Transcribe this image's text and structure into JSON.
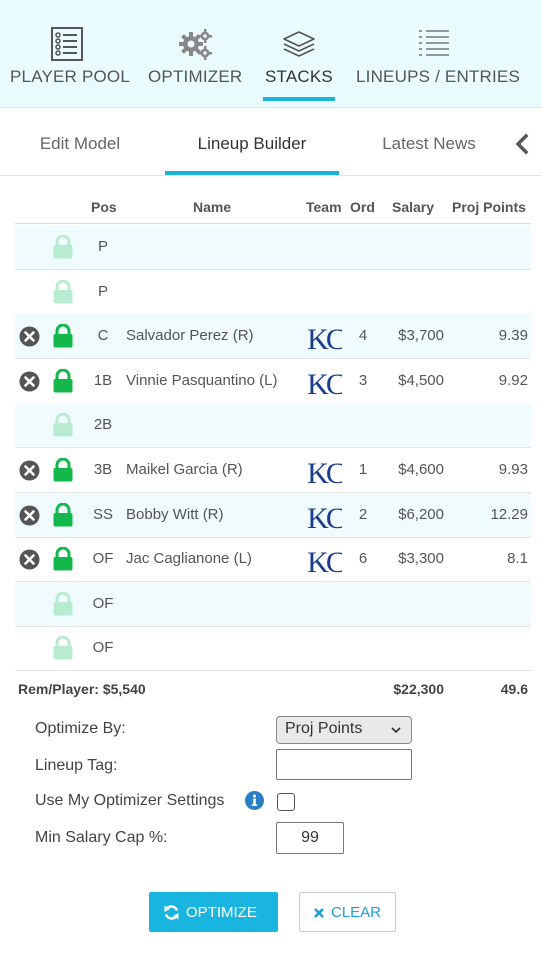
{
  "nav": {
    "player_pool": "PLAYER POOL",
    "optimizer": "OPTIMIZER",
    "stacks": "STACKS",
    "lineups": "LINEUPS / ENTRIES",
    "active": "stacks"
  },
  "subtabs": {
    "edit_model": "Edit Model",
    "lineup_builder": "Lineup Builder",
    "latest_news": "Latest News",
    "active": "lineup_builder"
  },
  "table": {
    "headers": {
      "pos": "Pos",
      "name": "Name",
      "team": "Team",
      "ord": "Ord",
      "salary": "Salary",
      "proj_points": "Proj Points"
    },
    "rows": [
      {
        "pos": "P",
        "name": "",
        "team": "",
        "ord": "",
        "salary": "",
        "proj": "",
        "locked": false,
        "filled": false
      },
      {
        "pos": "P",
        "name": "",
        "team": "",
        "ord": "",
        "salary": "",
        "proj": "",
        "locked": false,
        "filled": false
      },
      {
        "pos": "C",
        "name": "Salvador Perez (R)",
        "team": "KC",
        "ord": "4",
        "salary": "$3,700",
        "proj": "9.39",
        "locked": true,
        "filled": true
      },
      {
        "pos": "1B",
        "name": "Vinnie Pasquantino (L)",
        "team": "KC",
        "ord": "3",
        "salary": "$4,500",
        "proj": "9.92",
        "locked": true,
        "filled": true
      },
      {
        "pos": "2B",
        "name": "",
        "team": "",
        "ord": "",
        "salary": "",
        "proj": "",
        "locked": false,
        "filled": false
      },
      {
        "pos": "3B",
        "name": "Maikel Garcia (R)",
        "team": "KC",
        "ord": "1",
        "salary": "$4,600",
        "proj": "9.93",
        "locked": true,
        "filled": true
      },
      {
        "pos": "SS",
        "name": "Bobby Witt (R)",
        "team": "KC",
        "ord": "2",
        "salary": "$6,200",
        "proj": "12.29",
        "locked": true,
        "filled": true
      },
      {
        "pos": "OF",
        "name": "Jac Caglianone (L)",
        "team": "KC",
        "ord": "6",
        "salary": "$3,300",
        "proj": "8.1",
        "locked": true,
        "filled": true
      },
      {
        "pos": "OF",
        "name": "",
        "team": "",
        "ord": "",
        "salary": "",
        "proj": "",
        "locked": false,
        "filled": false
      },
      {
        "pos": "OF",
        "name": "",
        "team": "",
        "ord": "",
        "salary": "",
        "proj": "",
        "locked": false,
        "filled": false
      }
    ],
    "totals": {
      "rem_player": "Rem/Player: $5,540",
      "salary": "$22,300",
      "proj": "49.6"
    }
  },
  "form": {
    "optimize_by_label": "Optimize By:",
    "optimize_by_value": "Proj Points",
    "lineup_tag_label": "Lineup Tag:",
    "lineup_tag_value": "",
    "use_settings_label": "Use My Optimizer Settings",
    "use_settings_checked": false,
    "min_salary_label": "Min Salary Cap %:",
    "min_salary_value": "99"
  },
  "buttons": {
    "optimize": "OPTIMIZE",
    "clear": "CLEAR"
  },
  "colors": {
    "accent": "#1ab4d6",
    "button_blue": "#1ab4e0",
    "lock_green": "#12b84a",
    "lock_pale": "#b8ecd0",
    "row_alt": "#effbfd",
    "team_navy": "#1a3e8c"
  }
}
